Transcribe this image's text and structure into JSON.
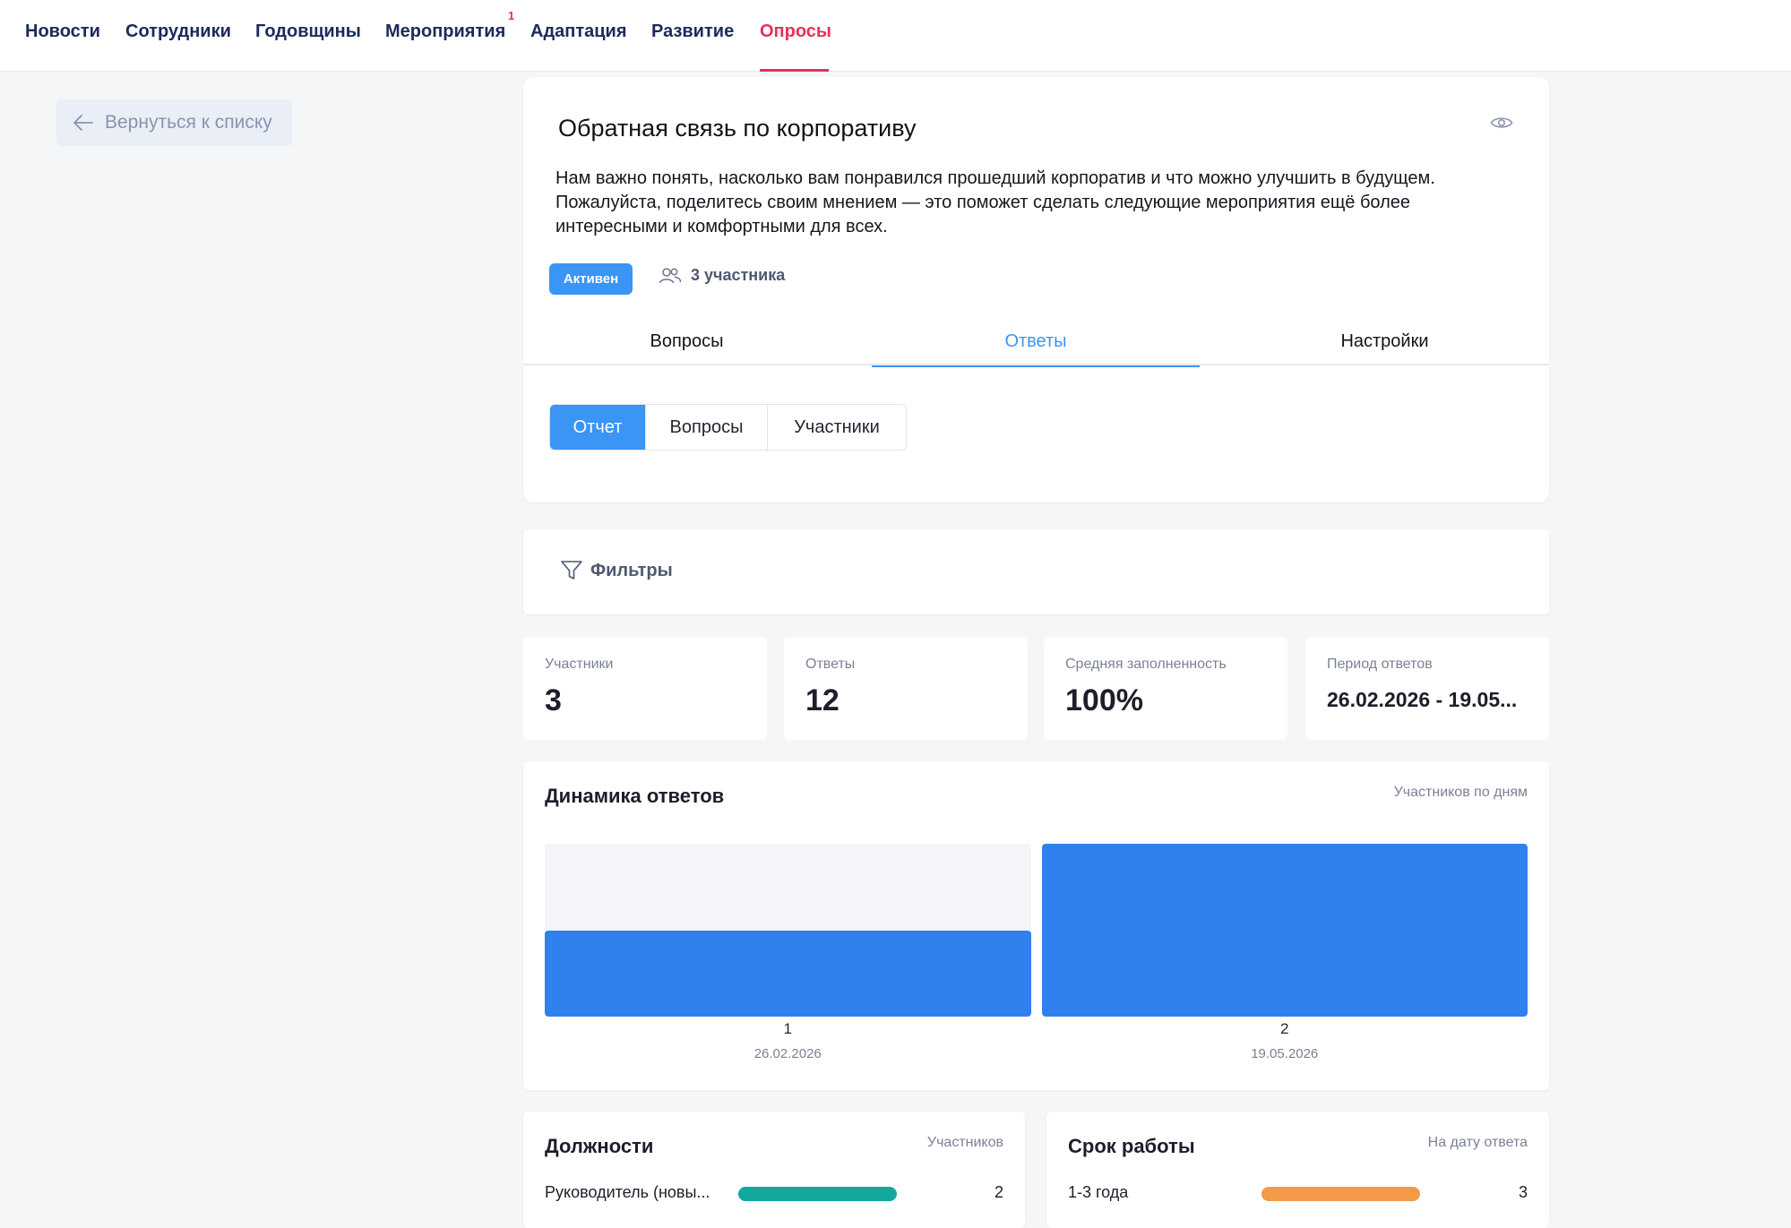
{
  "nav": {
    "items": [
      "Новости",
      "Сотрудники",
      "Годовщины",
      "Мероприятия",
      "Адаптация",
      "Развитие",
      "Опросы"
    ],
    "active_index": 6,
    "events_badge": "1"
  },
  "back_label": "Вернуться к списку",
  "survey": {
    "title": "Обратная связь по корпоративу",
    "description": "Нам важно понять, насколько вам понравился прошедший корпоратив и что можно улучшить в будущем. Пожалуйста, поделитесь своим мнением — это поможет сделать следующие мероприятия ещё более интересными и комфортными для всех.",
    "status": "Активен",
    "participants": "3 участника"
  },
  "tabs": [
    "Вопросы",
    "Ответы",
    "Настройки"
  ],
  "active_tab": 1,
  "subtabs": [
    "Отчет",
    "Вопросы",
    "Участники"
  ],
  "active_subtab": 0,
  "filters_label": "Фильтры",
  "stats": [
    {
      "label": "Участники",
      "value": "3"
    },
    {
      "label": "Ответы",
      "value": "12"
    },
    {
      "label": "Средняя заполненность",
      "value": "100%"
    },
    {
      "label": "Период ответов",
      "value": "26.02.2026 - 19.05..."
    }
  ],
  "dynamics": {
    "title": "Динамика ответов",
    "note": "Участников по дням"
  },
  "chart_data": {
    "type": "bar",
    "title": "Динамика ответов",
    "categories": [
      "26.02.2026",
      "19.05.2026"
    ],
    "values": [
      1,
      2
    ],
    "ylim": [
      0,
      2
    ],
    "colors": {
      "bar": "#3080ee",
      "track": "#f3f5f9"
    }
  },
  "positions": {
    "title": "Должности",
    "note": "Участников",
    "rows": [
      {
        "label": "Руководитель (новы...",
        "value": 2,
        "color": "#13a89e"
      }
    ]
  },
  "tenure": {
    "title": "Срок работы",
    "note": "На дату ответа",
    "rows": [
      {
        "label": "1-3 года",
        "value": 3,
        "color": "#f29a48"
      }
    ]
  },
  "colors": {
    "accent": "#3a95f5",
    "nav_active": "#e6305b"
  }
}
